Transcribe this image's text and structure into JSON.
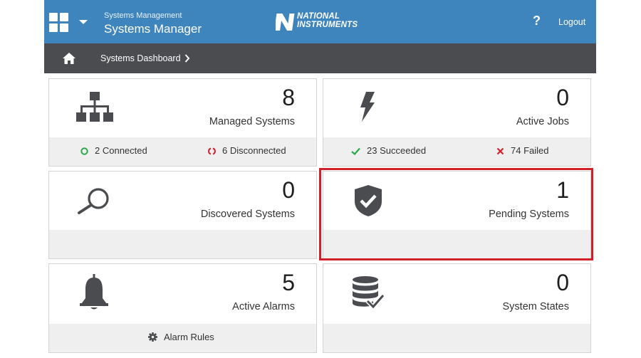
{
  "header": {
    "app_group": "Systems Management",
    "app_title": "Systems Manager",
    "brand_line1": "NATIONAL",
    "brand_line2": "INSTRUMENTS",
    "help_label": "?",
    "logout_label": "Logout"
  },
  "breadcrumb": {
    "item": "Systems Dashboard"
  },
  "tiles": {
    "managed": {
      "count": "8",
      "label": "Managed Systems",
      "connected": "2 Connected",
      "disconnected": "6 Disconnected"
    },
    "jobs": {
      "count": "0",
      "label": "Active Jobs",
      "succeeded": "23 Succeeded",
      "failed": "74 Failed"
    },
    "discovered": {
      "count": "0",
      "label": "Discovered Systems"
    },
    "pending": {
      "count": "1",
      "label": "Pending Systems"
    },
    "alarms": {
      "count": "5",
      "label": "Active Alarms",
      "rules": "Alarm Rules"
    },
    "states": {
      "count": "0",
      "label": "System States"
    }
  },
  "colors": {
    "header_bg": "#3f85bd",
    "breadcrumb_bg": "#4a4c50",
    "tile_footer_bg": "#efefef",
    "connected": "#2aa84a",
    "disconnected": "#d0202a",
    "succeeded": "#2aa84a",
    "failed": "#d0202a",
    "selection": "#d0202a"
  },
  "icons": {
    "apps": "grid-icon",
    "menu": "chevron-down-icon",
    "home": "home-icon",
    "managed": "network-tree-icon",
    "jobs": "lightning-icon",
    "discovered": "magnifier-icon",
    "pending": "shield-check-icon",
    "alarms": "bell-icon",
    "states": "database-check-icon",
    "alarm_rules": "gear-icon"
  }
}
